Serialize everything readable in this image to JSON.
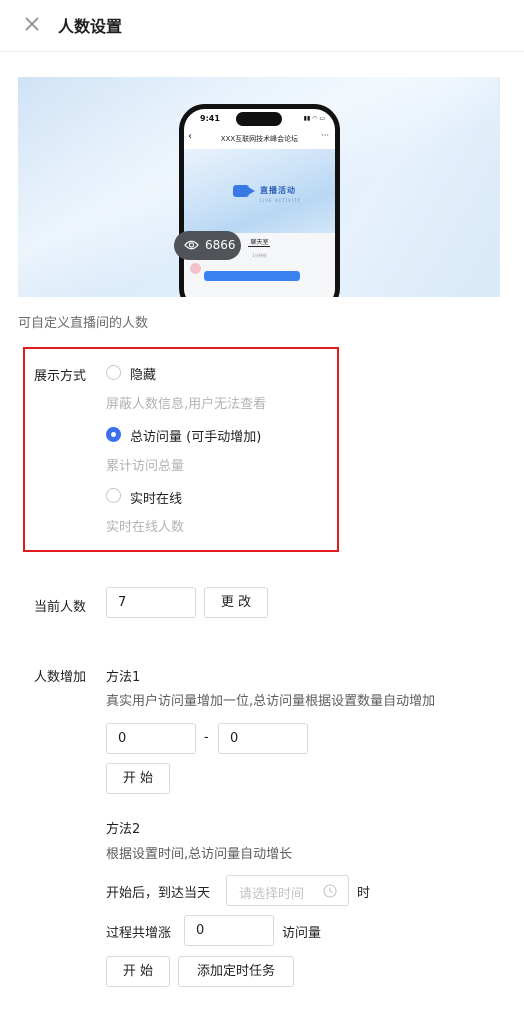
{
  "header": {
    "title": "人数设置"
  },
  "preview": {
    "phone_time": "9:41",
    "page_title": "XXX互联网技术峰会论坛",
    "banner_title": "直播活动",
    "banner_sub": "LIVE ACTIVITY",
    "chat_tab": "聊天室",
    "chat_time": "1分钟前",
    "viewer_count": "6866"
  },
  "hint": "可自定义直播间的人数",
  "display": {
    "label": "展示方式",
    "options": [
      {
        "label": "隐藏",
        "desc": "屏蔽人数信息,用户无法查看",
        "selected": false
      },
      {
        "label": "总访问量 (可手动增加)",
        "desc": "累计访问总量",
        "selected": true
      },
      {
        "label": "实时在线",
        "desc": "实时在线人数",
        "selected": false
      }
    ]
  },
  "current": {
    "label": "当前人数",
    "value": "7",
    "button": "更 改"
  },
  "increase": {
    "label": "人数增加",
    "method1": {
      "title": "方法1",
      "desc": "真实用户访问量增加一位,总访问量根据设置数量自动增加",
      "from": "0",
      "to": "0",
      "separator": "-",
      "start": "开 始"
    },
    "method2": {
      "title": "方法2",
      "desc": "根据设置时间,总访问量自动增长",
      "after_label": "开始后，到达当天",
      "time_placeholder": "请选择时间",
      "hour_unit": "时",
      "total_label": "过程共增涨",
      "total_value": "0",
      "total_unit": "访问量",
      "start": "开 始",
      "add_task": "添加定时任务"
    }
  }
}
